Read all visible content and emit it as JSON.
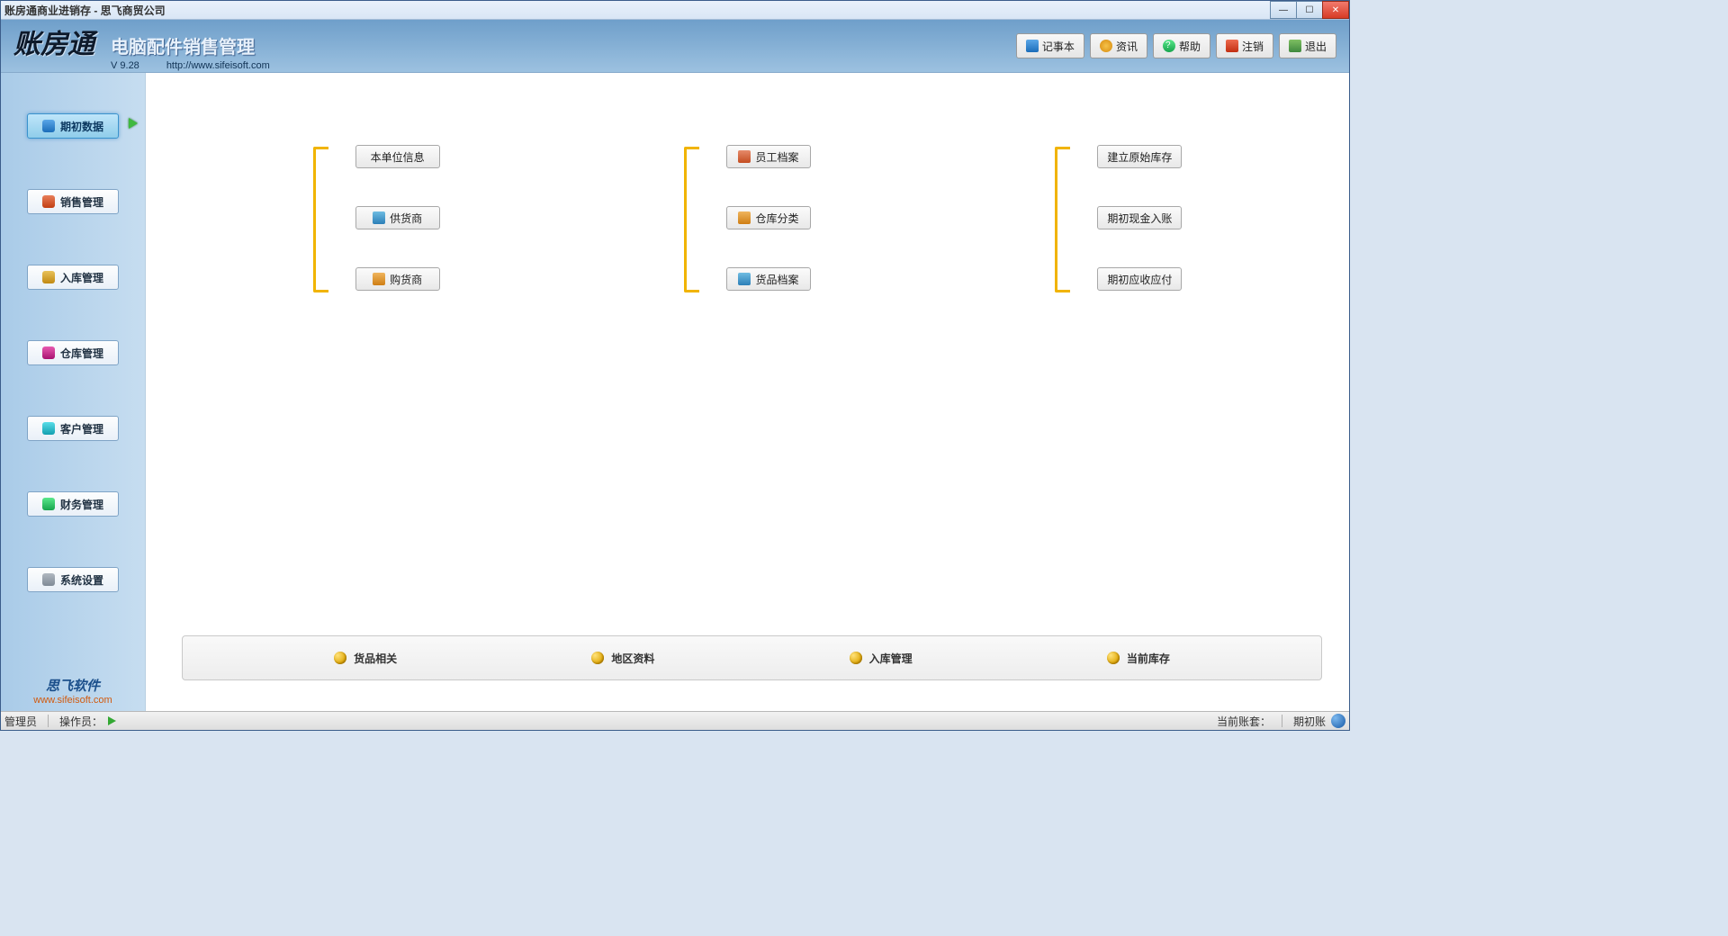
{
  "window": {
    "title": "账房通商业进销存 - 思飞商贸公司"
  },
  "header": {
    "logo": "账房通",
    "title": "电脑配件销售管理",
    "version": "V 9.28",
    "url": "http://www.sifeisoft.com"
  },
  "toolbar": {
    "notepad": "记事本",
    "info": "资讯",
    "help": "帮助",
    "logout": "注销",
    "exit": "退出"
  },
  "sidebar": {
    "items": [
      "期初数据",
      "销售管理",
      "入库管理",
      "仓库管理",
      "客户管理",
      "财务管理",
      "系统设置"
    ],
    "footer_name": "思飞软件",
    "footer_url": "www.sifeisoft.com"
  },
  "main": {
    "columns": [
      {
        "items": [
          "本单位信息",
          "供货商",
          "购货商"
        ]
      },
      {
        "items": [
          "员工档案",
          "仓库分类",
          "货品档案"
        ]
      },
      {
        "items": [
          "建立原始库存",
          "期初现金入账",
          "期初应收应付"
        ]
      }
    ],
    "bottom": [
      "货品相关",
      "地区资料",
      "入库管理",
      "当前库存"
    ]
  },
  "statusbar": {
    "role": "管理员",
    "operator_label": "操作员：",
    "account_label": "当前账套：",
    "period_label": "期初账"
  }
}
